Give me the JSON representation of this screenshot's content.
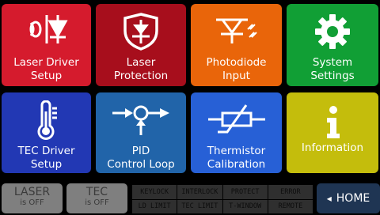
{
  "tiles": [
    {
      "line1": "Laser Driver",
      "line2": "Setup",
      "icon": "laser-diode-icon",
      "color": "#d51b2d"
    },
    {
      "line1": "Laser",
      "line2": "Protection",
      "icon": "shield-diode-icon",
      "color": "#a70e1c"
    },
    {
      "line1": "Photodiode",
      "line2": "Input",
      "icon": "photodiode-icon",
      "color": "#e9650a"
    },
    {
      "line1": "System",
      "line2": "Settings",
      "icon": "gear-icon",
      "color": "#119f35"
    },
    {
      "line1": "TEC Driver",
      "line2": "Setup",
      "icon": "thermometer-icon",
      "color": "#2238b4"
    },
    {
      "line1": "PID",
      "line2": "Control Loop",
      "icon": "pid-loop-icon",
      "color": "#2164a9"
    },
    {
      "line1": "Thermistor",
      "line2": "Calibration",
      "icon": "thermistor-icon",
      "color": "#2760d6"
    },
    {
      "line1": "Information",
      "line2": "",
      "icon": "info-icon",
      "color": "#c4bd0c"
    }
  ],
  "laser": {
    "title": "LASER",
    "state": "is OFF"
  },
  "tec": {
    "title": "TEC",
    "state": "is OFF"
  },
  "status": [
    "KEYLOCK",
    "INTERLOCK",
    "PROTECT",
    "ERROR",
    "LD LIMIT",
    "TEC LIMIT",
    "T-WINDOW",
    "REMOTE"
  ],
  "home": {
    "arrow": "◂",
    "label": "HOME"
  }
}
